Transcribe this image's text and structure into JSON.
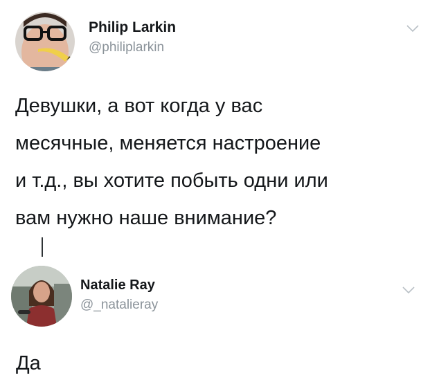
{
  "thread": {
    "tweets": [
      {
        "display_name": "Philip Larkin",
        "handle": "@philiplarkin",
        "text": "Девушки, а вот когда у вас\nмесячные, меняется настроение\nи т.д., вы хотите побыть одни или\nвам нужно наше внимание?",
        "avatar_icon": "avatar-man-glasses-banana",
        "menu_icon": "chevron-down-icon"
      },
      {
        "display_name": "Natalie Ray",
        "handle": "@_natalieray",
        "text": "Да",
        "avatar_icon": "avatar-woman-photo",
        "menu_icon": "chevron-down-icon"
      }
    ]
  },
  "colors": {
    "name": "#14171a",
    "handle": "#8a9299",
    "text": "#14171a",
    "chevron": "#b9c0c6",
    "thread_line": "#2f3336"
  }
}
